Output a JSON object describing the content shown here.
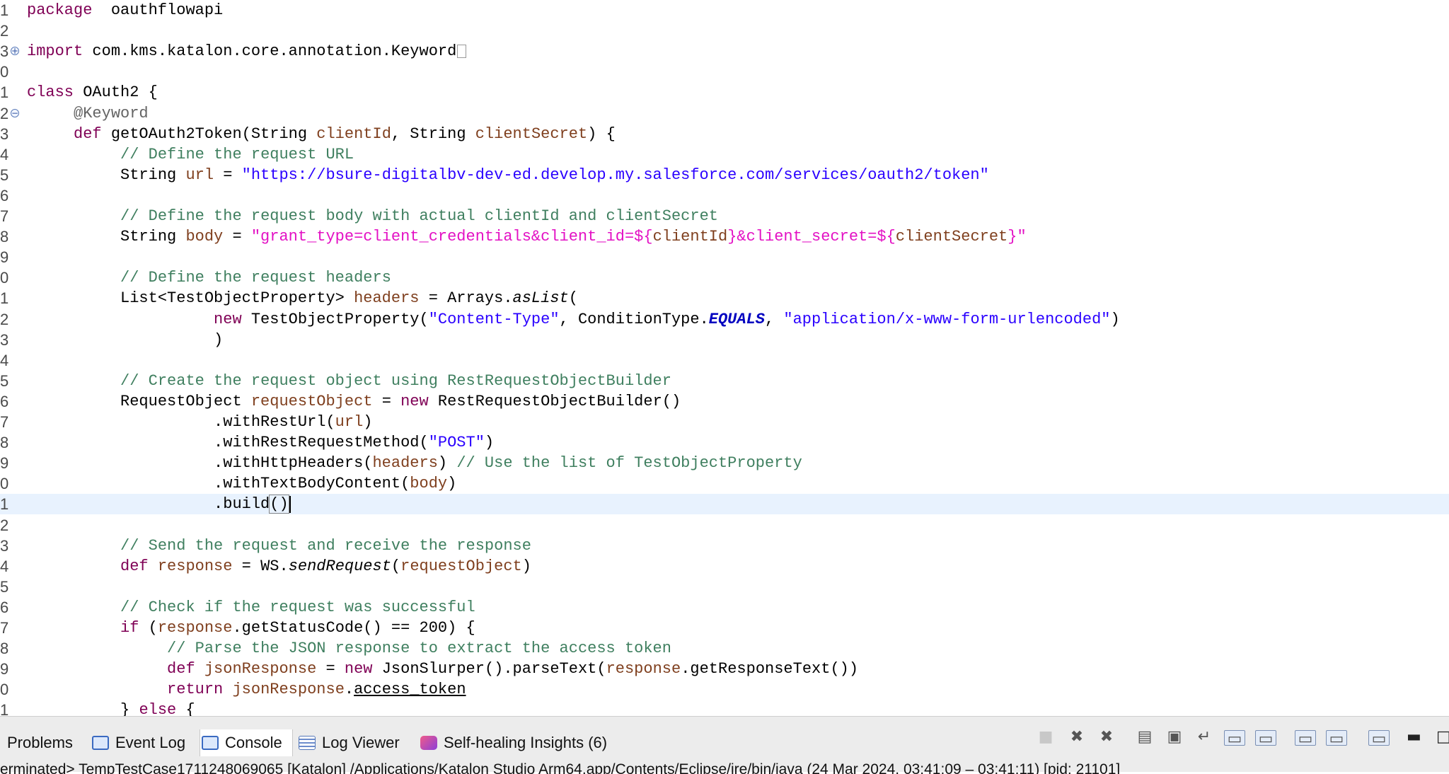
{
  "editor": {
    "lines": [
      {
        "no": "1",
        "tokens": [
          [
            "kw",
            "package"
          ],
          [
            "",
            "  oauthflowapi"
          ]
        ]
      },
      {
        "no": "2",
        "tokens": []
      },
      {
        "no": "3",
        "fold": "+",
        "tokens": [
          [
            "kw",
            "import"
          ],
          [
            "",
            " com.kms.katalon.core.annotation.Keyword"
          ]
        ],
        "folded": true
      },
      {
        "no": "0",
        "tokens": []
      },
      {
        "no": "1",
        "tokens": [
          [
            "kw",
            "class"
          ],
          [
            "",
            " OAuth2 {"
          ]
        ]
      },
      {
        "no": "2",
        "fold": "−",
        "tokens": [
          [
            "",
            "     "
          ],
          [
            "ann",
            "@Keyword"
          ]
        ]
      },
      {
        "no": "3",
        "tokens": [
          [
            "",
            "     "
          ],
          [
            "kw",
            "def"
          ],
          [
            "",
            " getOAuth2Token(String "
          ],
          [
            "fd",
            "clientId"
          ],
          [
            "",
            ", String "
          ],
          [
            "fd",
            "clientSecret"
          ],
          [
            "",
            ") {"
          ]
        ]
      },
      {
        "no": "4",
        "tokens": [
          [
            "",
            "          "
          ],
          [
            "cm",
            "// Define the request URL"
          ]
        ]
      },
      {
        "no": "5",
        "tokens": [
          [
            "",
            "          String "
          ],
          [
            "fd",
            "url"
          ],
          [
            "",
            " = "
          ],
          [
            "st",
            "\"https://bsure-digitalbv-dev-ed.develop.my.salesforce.com/services/oauth2/token\""
          ]
        ]
      },
      {
        "no": "6",
        "tokens": []
      },
      {
        "no": "7",
        "tokens": [
          [
            "",
            "          "
          ],
          [
            "cm",
            "// Define the request body with actual clientId and clientSecret"
          ]
        ]
      },
      {
        "no": "8",
        "tokens": [
          [
            "",
            "          String "
          ],
          [
            "fd",
            "body"
          ],
          [
            "",
            " = "
          ],
          [
            "gs",
            "\"grant_type=client_credentials&client_id=${"
          ],
          [
            "fd",
            "clientId"
          ],
          [
            "gs",
            "}&client_secret=${"
          ],
          [
            "fd",
            "clientSecret"
          ],
          [
            "gs",
            "}\""
          ]
        ]
      },
      {
        "no": "9",
        "tokens": []
      },
      {
        "no": "0",
        "tokens": [
          [
            "",
            "          "
          ],
          [
            "cm",
            "// Define the request headers"
          ]
        ]
      },
      {
        "no": "1",
        "tokens": [
          [
            "",
            "          List<TestObjectProperty> "
          ],
          [
            "fd",
            "headers"
          ],
          [
            "",
            " = Arrays."
          ],
          [
            "sm",
            "asList"
          ],
          [
            "",
            "("
          ]
        ]
      },
      {
        "no": "2",
        "tokens": [
          [
            "",
            "                    "
          ],
          [
            "kw",
            "new"
          ],
          [
            "",
            " TestObjectProperty("
          ],
          [
            "st",
            "\"Content-Type\""
          ],
          [
            "",
            ", ConditionType."
          ],
          [
            "cst",
            "EQUALS"
          ],
          [
            "",
            ", "
          ],
          [
            "st",
            "\"application/x-www-form-urlencoded\""
          ],
          [
            "",
            ")"
          ]
        ]
      },
      {
        "no": "3",
        "tokens": [
          [
            "",
            "                    )"
          ]
        ]
      },
      {
        "no": "4",
        "tokens": []
      },
      {
        "no": "5",
        "tokens": [
          [
            "",
            "          "
          ],
          [
            "cm",
            "// Create the request object using RestRequestObjectBuilder"
          ]
        ]
      },
      {
        "no": "6",
        "tokens": [
          [
            "",
            "          RequestObject "
          ],
          [
            "fd",
            "requestObject"
          ],
          [
            "",
            " = "
          ],
          [
            "kw",
            "new"
          ],
          [
            "",
            " RestRequestObjectBuilder()"
          ]
        ]
      },
      {
        "no": "7",
        "tokens": [
          [
            "",
            "                    .withRestUrl("
          ],
          [
            "fd",
            "url"
          ],
          [
            "",
            ")"
          ]
        ]
      },
      {
        "no": "8",
        "tokens": [
          [
            "",
            "                    .withRestRequestMethod("
          ],
          [
            "st",
            "\"POST\""
          ],
          [
            "",
            ")"
          ]
        ]
      },
      {
        "no": "9",
        "tokens": [
          [
            "",
            "                    .withHttpHeaders("
          ],
          [
            "fd",
            "headers"
          ],
          [
            "",
            ") "
          ],
          [
            "cm",
            "// Use the list of TestObjectProperty"
          ]
        ]
      },
      {
        "no": "0",
        "tokens": [
          [
            "",
            "                    .withTextBodyContent("
          ],
          [
            "fd",
            "body"
          ],
          [
            "",
            ")"
          ]
        ]
      },
      {
        "no": "1",
        "current": true,
        "tokens": [
          [
            "",
            "                    .build"
          ],
          [
            "caret-pair",
            "()"
          ]
        ],
        "caret": true
      },
      {
        "no": "2",
        "tokens": []
      },
      {
        "no": "3",
        "tokens": [
          [
            "",
            "          "
          ],
          [
            "cm",
            "// Send the request and receive the response"
          ]
        ]
      },
      {
        "no": "4",
        "tokens": [
          [
            "",
            "          "
          ],
          [
            "kw",
            "def"
          ],
          [
            "",
            " "
          ],
          [
            "fd",
            "response"
          ],
          [
            "",
            " = WS."
          ],
          [
            "sm",
            "sendRequest"
          ],
          [
            "",
            "("
          ],
          [
            "fd",
            "requestObject"
          ],
          [
            "",
            ")"
          ]
        ]
      },
      {
        "no": "5",
        "tokens": []
      },
      {
        "no": "6",
        "tokens": [
          [
            "",
            "          "
          ],
          [
            "cm",
            "// Check if the request was successful"
          ]
        ]
      },
      {
        "no": "7",
        "tokens": [
          [
            "",
            "          "
          ],
          [
            "kw",
            "if"
          ],
          [
            "",
            " ("
          ],
          [
            "fd",
            "response"
          ],
          [
            "",
            ".getStatusCode() == 200) {"
          ]
        ]
      },
      {
        "no": "8",
        "tokens": [
          [
            "",
            "               "
          ],
          [
            "cm",
            "// Parse the JSON response to extract the access token"
          ]
        ]
      },
      {
        "no": "9",
        "tokens": [
          [
            "",
            "               "
          ],
          [
            "kw",
            "def"
          ],
          [
            "",
            " "
          ],
          [
            "fd",
            "jsonResponse"
          ],
          [
            "",
            " = "
          ],
          [
            "kw",
            "new"
          ],
          [
            "",
            " JsonSlurper().parseText("
          ],
          [
            "fd",
            "response"
          ],
          [
            "",
            ".getResponseText())"
          ]
        ]
      },
      {
        "no": "0",
        "tokens": [
          [
            "",
            "               "
          ],
          [
            "kw",
            "return"
          ],
          [
            "",
            " "
          ],
          [
            "fd",
            "jsonResponse"
          ],
          [
            "",
            "."
          ],
          [
            "ul",
            "access_token"
          ]
        ]
      },
      {
        "no": "1",
        "tokens": [
          [
            "",
            "          } "
          ],
          [
            "kw",
            "else"
          ],
          [
            "",
            " {"
          ]
        ]
      }
    ]
  },
  "bottom_panel": {
    "tabs": [
      {
        "label": "Problems",
        "icon": "none"
      },
      {
        "label": "Event Log",
        "icon": "event-log-icon"
      },
      {
        "label": "Console",
        "icon": "console-icon",
        "active": true
      },
      {
        "label": "Log Viewer",
        "icon": "log-viewer-icon"
      },
      {
        "label": "Self-healing Insights (6)",
        "icon": "self-healing-icon"
      }
    ],
    "toolbar_icons": [
      "terminate-icon",
      "remove-launch-icon",
      "remove-all-launches-icon",
      "clear-console-icon",
      "scroll-lock-icon",
      "word-wrap-icon",
      "show-on-output-icon",
      "show-on-error-icon",
      "pin-console-icon",
      "display-console-icon",
      "open-console-icon",
      "minimize-icon",
      "maximize-icon"
    ],
    "status_line": "erminated> TempTestCase1711248069065 [Katalon] /Applications/Katalon Studio Arm64.app/Contents/Eclipse/jre/bin/java  (24 Mar 2024, 03:41:09 – 03:41:11) [pid: 21101]"
  },
  "colors": {
    "keyword": "#7f0055",
    "comment": "#3f7f5f",
    "string": "#2a00ff",
    "gstring": "#e311c4",
    "field": "#7f3f1e",
    "current_line": "#e8f2fe"
  }
}
